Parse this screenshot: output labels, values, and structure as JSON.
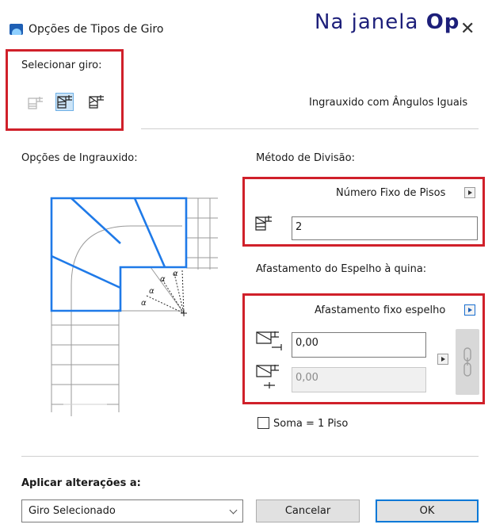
{
  "window": {
    "title": "Opções de Tipos de Giro",
    "close_glyph": "✕"
  },
  "overlay": {
    "prefix": "Na janela ",
    "bold": "Op"
  },
  "select_turn": {
    "label": "Selecionar giro:",
    "types": [
      "turn-type-1-icon",
      "turn-type-2-icon",
      "turn-type-3-icon"
    ],
    "selected_index": 1,
    "current_name": "Ingrauxido com Ângulos Iguais"
  },
  "winder_options": {
    "label": "Opções de Ingrauxido:",
    "angle_symbol": "α"
  },
  "division": {
    "label": "Método de Divisão:",
    "method": "Número Fixo de Pisos",
    "value": "2"
  },
  "offset": {
    "label": "Afastamento do Espelho à quina:",
    "method": "Afastamento fixo espelho",
    "value_1": "0,00",
    "value_2": "0,00"
  },
  "sum": {
    "label": "Soma = 1 Piso",
    "checked": false
  },
  "apply": {
    "label": "Aplicar alterações a:",
    "selected": "Giro Selecionado"
  },
  "buttons": {
    "cancel": "Cancelar",
    "ok": "OK"
  },
  "colors": {
    "accent": "#0078d7",
    "highlight": "#d0202a",
    "stair_blue": "#1f7ae8"
  }
}
